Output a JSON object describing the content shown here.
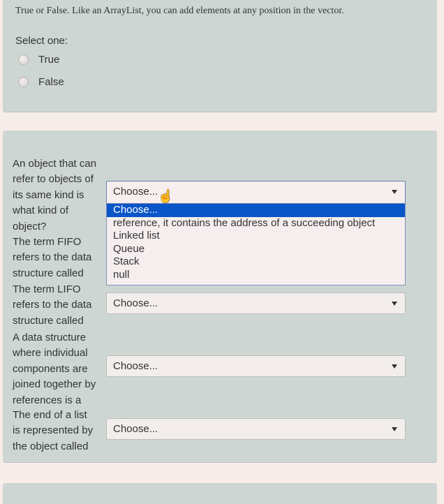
{
  "question1": {
    "text": "True or False. Like an ArrayList, you can add elements at any position in the vector.",
    "select_one_label": "Select one:",
    "options": [
      {
        "label": "True",
        "selected": false
      },
      {
        "label": "False",
        "selected": false
      }
    ]
  },
  "question2": {
    "items": [
      {
        "prompt_lines": [
          "An object that can",
          "refer to objects of",
          "its same kind is",
          "what kind of",
          "object?"
        ],
        "selected": "Choose...",
        "open": true
      },
      {
        "prompt_lines": [
          "The term FIFO",
          "refers to the data",
          "structure called"
        ],
        "selected": "Choose...",
        "open": false
      },
      {
        "prompt_lines": [
          "The term LIFO",
          "refers to the data",
          "structure called"
        ],
        "selected": "Choose...",
        "open": false
      },
      {
        "prompt_lines": [
          "A data structure",
          "where individual",
          "components are",
          "joined together by",
          "references is a"
        ],
        "selected": "Choose...",
        "open": false
      },
      {
        "prompt_lines": [
          "The end of a list",
          "is represented by",
          "the object called"
        ],
        "selected": "Choose...",
        "open": false
      }
    ],
    "dropdown_options": [
      "Choose...",
      "reference, it contains the address of a succeeding object",
      "Linked list",
      "Queue",
      "Stack",
      "null"
    ],
    "highlighted_option_index": 0
  },
  "colors": {
    "card_bg": "#cdd6d3",
    "page_bg": "#f6ece8",
    "highlight": "#0a55c8"
  }
}
